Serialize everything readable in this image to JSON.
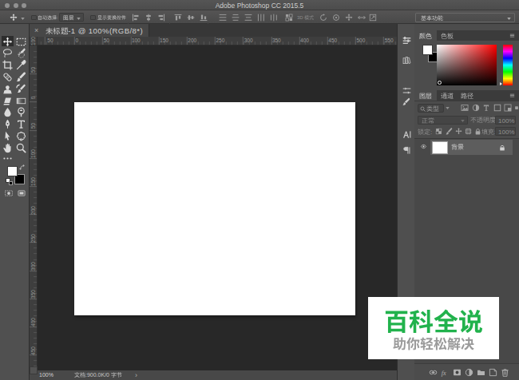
{
  "window": {
    "title": "Adobe Photoshop CC 2015.5",
    "traffic_lights": [
      "close",
      "minimize",
      "zoom"
    ]
  },
  "options_bar": {
    "tool_icon": "move-tool",
    "auto_select": {
      "label": "自动选择:",
      "checked": false,
      "value": "图层"
    },
    "show_transform": {
      "label": "显示变换控件",
      "checked": false
    },
    "align_icons": [
      "align-left-edges",
      "align-horizontal-centers",
      "align-right-edges",
      "align-top-edges",
      "align-vertical-centers",
      "align-bottom-edges"
    ],
    "distribute_icons": [
      "distribute-top-edges",
      "distribute-vertical-centers",
      "distribute-bottom-edges",
      "distribute-left-edges",
      "distribute-horizontal-centers"
    ],
    "auto_align_icon": "auto-align-layers",
    "mode_3d_label": "3D 模式",
    "threed_icons": [
      "3d-rotate",
      "3d-roll",
      "3d-drag",
      "3d-slide",
      "3d-scale"
    ],
    "workspace": {
      "value": "基本功能"
    }
  },
  "document_tab": {
    "close": "×",
    "title": "未标题-1 @ 100%(RGB/8*)"
  },
  "rulers": {
    "horizontal_labels": [
      "50",
      "0",
      "50",
      "100",
      "150",
      "200",
      "250",
      "300",
      "350",
      "400",
      "450",
      "500",
      "550"
    ],
    "vertical_labels": [
      "100",
      "50",
      "0",
      "50",
      "100",
      "150",
      "200",
      "250",
      "300",
      "350",
      "400",
      "450"
    ]
  },
  "toolbar": {
    "tools": [
      {
        "name": "move-tool",
        "selected": true
      },
      {
        "name": "rectangular-marquee-tool",
        "selected": false
      },
      {
        "name": "lasso-tool",
        "selected": false
      },
      {
        "name": "quick-selection-tool",
        "selected": false
      },
      {
        "name": "crop-tool",
        "selected": false
      },
      {
        "name": "eyedropper-tool",
        "selected": false
      },
      {
        "name": "spot-healing-brush-tool",
        "selected": false
      },
      {
        "name": "brush-tool",
        "selected": false
      },
      {
        "name": "clone-stamp-tool",
        "selected": false
      },
      {
        "name": "history-brush-tool",
        "selected": false
      },
      {
        "name": "eraser-tool",
        "selected": false
      },
      {
        "name": "gradient-tool",
        "selected": false
      },
      {
        "name": "blur-tool",
        "selected": false
      },
      {
        "name": "dodge-tool",
        "selected": false
      },
      {
        "name": "pen-tool",
        "selected": false
      },
      {
        "name": "type-tool",
        "selected": false
      },
      {
        "name": "path-selection-tool",
        "selected": false
      },
      {
        "name": "custom-shape-tool",
        "selected": false
      },
      {
        "name": "hand-tool",
        "selected": false
      },
      {
        "name": "zoom-tool",
        "selected": false
      }
    ],
    "edit_toolbar_icon": "ellipsis",
    "colors": {
      "foreground": "#ffffff",
      "background": "#000000"
    },
    "bottom_icons": [
      "quick-mask-mode",
      "screen-mode"
    ]
  },
  "panel_strip": {
    "icons": [
      "color-knobs-panel",
      "libraries-panel",
      "adjustments-panel",
      "styles-panel",
      "character-panel",
      "paragraph-panel"
    ]
  },
  "color_panel": {
    "tabs": [
      {
        "label": "颜色",
        "active": true
      },
      {
        "label": "色板",
        "active": false
      }
    ],
    "foreground": "#ffffff",
    "background": "#000000",
    "hue_gradient": [
      "#ff0000",
      "#ff00ff",
      "#0000ff",
      "#00ffff",
      "#00ff00",
      "#ffff00",
      "#ff0000"
    ],
    "sv_hue": "#ff0000"
  },
  "layers_panel": {
    "tabs": [
      {
        "label": "图层",
        "active": true
      },
      {
        "label": "通道",
        "active": false
      },
      {
        "label": "路径",
        "active": false
      }
    ],
    "filter": {
      "kind_label": "类型",
      "icons": [
        "filter-image",
        "filter-adjustment",
        "filter-type",
        "filter-shape",
        "filter-smart-object"
      ],
      "toggle_icon": "filter-toggle"
    },
    "blend_mode": "正常",
    "opacity_label": "不透明度:",
    "opacity_value": "100%",
    "lock_label": "锁定:",
    "lock_icons": [
      "lock-transparent-pixels",
      "lock-image-pixels",
      "lock-position",
      "lock-artboard",
      "lock-all"
    ],
    "fill_label": "填充:",
    "fill_value": "100%",
    "layers": [
      {
        "name": "背景",
        "visible": true,
        "locked": true,
        "thumbnail": "#ffffff",
        "selected": true
      }
    ],
    "footer_icons": [
      "link-layers",
      "layer-style-fx",
      "add-layer-mask",
      "new-adjustment-layer",
      "new-group",
      "new-layer",
      "delete-layer"
    ]
  },
  "status_bar": {
    "zoom": "100%",
    "doc_info": "文档:900.0K/0 字节",
    "chevron": "›"
  },
  "watermark": {
    "title": "百科全说",
    "subtitle": "助你轻松解决",
    "title_color": "#21b24c"
  }
}
